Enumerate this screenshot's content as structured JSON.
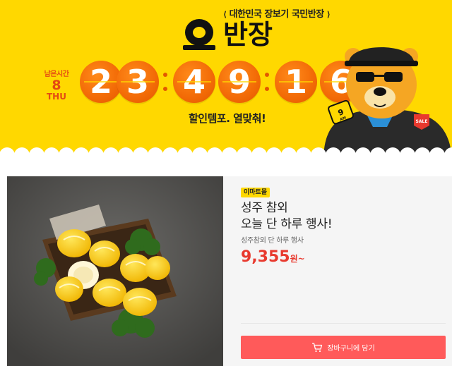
{
  "banner": {
    "tagline": "대한민국 장보기 국민반장",
    "logo_text": "오반장",
    "remaining_label": "남은시간",
    "date_number": "8",
    "weekday": "THU",
    "countdown_digits": [
      "2",
      "3",
      "4",
      "9",
      "1",
      "6"
    ],
    "sale_text": "할인템포. 열맞춰!",
    "mascot_badge": "9AM",
    "mascot_patch": "SALE"
  },
  "product": {
    "store_badge": "이마트몰",
    "title_line1": "성주 참외",
    "title_line2": "오늘 단 하루 행사!",
    "subtitle": "성주참외 단 하루 행사",
    "price": "9,355",
    "price_unit": "원~",
    "cart_button": "장바구니에 담기"
  },
  "colors": {
    "banner_bg": "#ffd800",
    "digit_orange": "#f26a06",
    "price_red": "#e8392e",
    "cart_button": "#ff5a5a"
  },
  "icons": {
    "cart": "cart-icon"
  }
}
